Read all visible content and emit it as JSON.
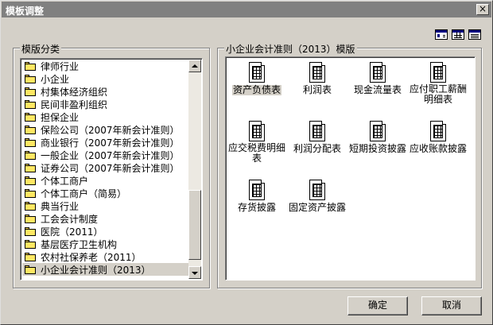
{
  "window": {
    "title": "模板调整",
    "close_symbol": "×"
  },
  "toolbar": {
    "view_icons": [
      "large-icons-view-icon",
      "small-icons-view-icon",
      "details-view-icon"
    ]
  },
  "categories": {
    "label": "模版分类",
    "items": [
      {
        "label": "律师行业"
      },
      {
        "label": "小企业"
      },
      {
        "label": "村集体经济组织"
      },
      {
        "label": "民间非盈利组织"
      },
      {
        "label": "担保企业"
      },
      {
        "label": "保险公司（2007年新会计准则）"
      },
      {
        "label": "商业银行（2007年新会计准则）"
      },
      {
        "label": "一般企业（2007年新会计准则）"
      },
      {
        "label": "证券公司（2007年新会计准则）"
      },
      {
        "label": "个体工商户"
      },
      {
        "label": "个体工商户（简易）"
      },
      {
        "label": "典当行业"
      },
      {
        "label": "工会会计制度"
      },
      {
        "label": "医院（2011）"
      },
      {
        "label": "基层医疗卫生机构"
      },
      {
        "label": "农村社保养老（2011）"
      },
      {
        "label": "小企业会计准则（2013）",
        "selected": true
      }
    ]
  },
  "templates": {
    "label": "小企业会计准则（2013）模版",
    "items": [
      {
        "label": "资产负债表",
        "selected": true
      },
      {
        "label": "利润表"
      },
      {
        "label": "现金流量表"
      },
      {
        "label": "应付职工薪酬明细表"
      },
      {
        "label": "应交税费明细表"
      },
      {
        "label": "利润分配表"
      },
      {
        "label": "短期投资披露"
      },
      {
        "label": "应收账款披露"
      },
      {
        "label": "存货披露"
      },
      {
        "label": "固定资产披露"
      }
    ]
  },
  "buttons": {
    "ok": "确定",
    "cancel": "取消"
  }
}
